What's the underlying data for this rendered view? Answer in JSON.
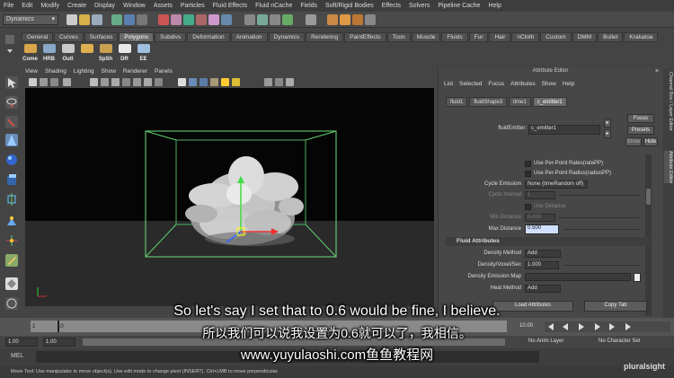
{
  "menubar": [
    "File",
    "Edit",
    "Modify",
    "Create",
    "Display",
    "Window",
    "Assets",
    "Particles",
    "Fluid Effects",
    "Fluid nCache",
    "Fields",
    "Soft/Rigid Bodies",
    "Effects",
    "Solvers",
    "Pipeline Cache",
    "Help"
  ],
  "status": {
    "mode": "Dynamics"
  },
  "shelf": {
    "tabs": [
      "General",
      "Curves",
      "Surfaces",
      "Polygons",
      "Subdivs",
      "Deformation",
      "Animation",
      "Dynamics",
      "Rendering",
      "PaintEffects",
      "Toon",
      "Muscle",
      "Fluids",
      "Fur",
      "Hair",
      "nCloth",
      "Custom",
      "DMM",
      "Bullet",
      "Krakatoa"
    ],
    "active_tab": "Polygons",
    "buttons": [
      {
        "label": "Come",
        "color": "#d9a64a"
      },
      {
        "label": "HRB",
        "color": "#8aa8c8"
      },
      {
        "label": "Outl",
        "color": "#c8c8c8"
      },
      {
        "label": "",
        "color": "#e0b050"
      },
      {
        "label": "SpSh",
        "color": "#c8a050"
      },
      {
        "label": "DR",
        "color": "#e8e8e8"
      },
      {
        "label": "EE",
        "color": "#a0c0e0"
      }
    ]
  },
  "panel": {
    "menu": [
      "View",
      "Shading",
      "Lighting",
      "Show",
      "Renderer",
      "Panels"
    ]
  },
  "attribute_editor": {
    "title": "Attribute Editor",
    "menu": [
      "List",
      "Selected",
      "Focus",
      "Attributes",
      "Show",
      "Help"
    ],
    "tabs": [
      "fluid1",
      "fluidShape3",
      "time1",
      "c_emitter1"
    ],
    "active_tab": "c_emitter1",
    "node_label": "fluidEmitter:",
    "node_value": "c_emitter1",
    "focus_btn": "Focus",
    "presets_btn": "Presets",
    "show_btn": "Show",
    "hide_btn": "Hide",
    "per_point_rate": "Use Per-Point Rates(ratePP)",
    "per_point_radius": "Use Per-Point Radius(radiusPP)",
    "cycle_emission_label": "Cycle Emission",
    "cycle_emission_value": "None (timeRandom off)",
    "cycle_interval_label": "Cycle Interval",
    "cycle_interval_value": "1",
    "use_distance": "Use Distance",
    "min_distance_label": "Min Distance",
    "min_distance_value": "0.000",
    "max_distance_label": "Max Distance",
    "max_distance_value": "0.500",
    "fluid_attributes": "Fluid Attributes",
    "density_method_label": "Density Method",
    "density_method_value": "Add",
    "density_voxel_label": "Density/Voxel/Sec",
    "density_voxel_value": "1.000",
    "density_map_label": "Density Emission Map",
    "heat_method_label": "Heat Method",
    "heat_method_value": "Add",
    "load_attributes_btn": "Load Attributes",
    "copy_tab_btn": "Copy Tab"
  },
  "side_tabs": [
    "Channel Box / Layer Editor",
    "Attribute Editor"
  ],
  "timeline": {
    "ticks": [
      "1",
      "",
      "10",
      "",
      "",
      "",
      "",
      "",
      "",
      "",
      "",
      "",
      ""
    ],
    "current_frame": "10.00"
  },
  "range": {
    "start": "1.00",
    "playback_start": "1.00",
    "anim_layer": "No Anim Layer",
    "char_set": "No Character Set"
  },
  "mel": {
    "label": "MEL"
  },
  "helpline": "Move Tool: Use manipulator to move object(s). Use edit mode to change pivot (INSERT). Ctrl+LMB to move perpendicular.",
  "subtitles": {
    "en": "So let's say I set that to 0.6 would be fine, I believe.",
    "zh": "所以我们可以说我设置为0.6就可以了，我相信。",
    "url": "www.yuyulaoshi.com鱼鱼教程网"
  },
  "watermark": "pluralsight"
}
